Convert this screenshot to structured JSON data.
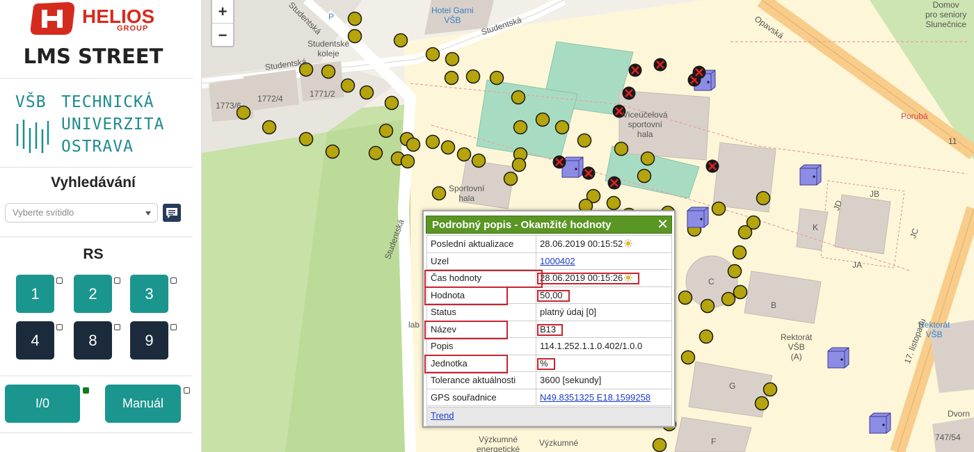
{
  "brand": {
    "name": "HELIOS",
    "subname": "GROUP"
  },
  "app_title": "LMS STREET",
  "university": {
    "line1": "VŠB",
    "line2": "TECHNICKÁ",
    "line3": "UNIVERZITA",
    "line4": "OSTRAVA"
  },
  "search": {
    "title": "Vyhledávání",
    "select_placeholder": "Vyberte svítidlo"
  },
  "rs": {
    "title": "RS",
    "buttons": [
      {
        "label": "1",
        "style": "teal"
      },
      {
        "label": "2",
        "style": "teal"
      },
      {
        "label": "3",
        "style": "teal"
      },
      {
        "label": "4",
        "style": "dark"
      },
      {
        "label": "8",
        "style": "dark"
      },
      {
        "label": "9",
        "style": "dark"
      }
    ]
  },
  "controls": {
    "io_label": "I/0",
    "io_led": "on",
    "manual_label": "Manuál",
    "manual_led": "off"
  },
  "map": {
    "zoom_in": "+",
    "zoom_out": "−",
    "labels": [
      {
        "text": "Studentská"
      },
      {
        "text": "Studentská"
      },
      {
        "text": "Studentská"
      },
      {
        "text": "Studentská"
      },
      {
        "text": "Studentské\nkoleje"
      },
      {
        "text": "Hotel Garni\nVŠB"
      },
      {
        "text": "Opavská"
      },
      {
        "text": "Domov\npro seniory\nSlunečnice"
      },
      {
        "text": "Porubá"
      },
      {
        "text": "1773/6"
      },
      {
        "text": "1772/4"
      },
      {
        "text": "1771/2"
      },
      {
        "text": "Viceúčelová\nsportovní\nhala"
      },
      {
        "text": "Sportovní\nhala"
      },
      {
        "text": "JB"
      },
      {
        "text": "JC"
      },
      {
        "text": "JD"
      },
      {
        "text": "JA"
      },
      {
        "text": "K"
      },
      {
        "text": "C"
      },
      {
        "text": "B"
      },
      {
        "text": "Rektorát\nVŠB\n(A)"
      },
      {
        "text": "Rektorát\nVŠB"
      },
      {
        "text": "G"
      },
      {
        "text": "F"
      },
      {
        "text": "17. listopadu"
      },
      {
        "text": "Dvorn"
      },
      {
        "text": "747/54"
      },
      {
        "text": "11"
      },
      {
        "text": "Výzkumné\nenergetické"
      },
      {
        "text": "Výzkumné"
      },
      {
        "text": "lab"
      },
      {
        "text": "P"
      }
    ]
  },
  "popup": {
    "title": "Podrobný popis - Okamžité hodnoty",
    "close": "✕",
    "rows": [
      {
        "key": "Poslední aktualizace",
        "value": "28.06.2019 00:15:52",
        "icon": "sun-icon",
        "link": false,
        "highlight": false
      },
      {
        "key": "Uzel",
        "value": "1000402",
        "link": true,
        "highlight": false
      },
      {
        "key": "Čas hodnoty",
        "value": "28.06.2019 00:15:26",
        "icon": "sun-icon",
        "link": false,
        "highlight": true
      },
      {
        "key": "Hodnota",
        "value": "50,00",
        "link": false,
        "highlight": true
      },
      {
        "key": "Status",
        "value": "platný údaj [0]",
        "link": false,
        "highlight": false
      },
      {
        "key": "Název",
        "value": "B13",
        "link": false,
        "highlight": true
      },
      {
        "key": "Popis",
        "value": "114.1.252.1.1.0.402/1.0.0",
        "link": false,
        "highlight": false
      },
      {
        "key": "Jednotka",
        "value": "%",
        "link": false,
        "highlight": true
      },
      {
        "key": "Tolerance aktuálnosti",
        "value": "3600 [sekundy]",
        "link": false,
        "highlight": false
      },
      {
        "key": "GPS souřadnice",
        "value": "N49.8351325 E18.1599258",
        "link": true,
        "highlight": false
      }
    ],
    "trend": "Trend"
  },
  "colors": {
    "teal": "#1a968f",
    "dark": "#1c2b3b",
    "brand_red": "#d52b1e",
    "popup_header": "#5a9624",
    "lamp": "#b5a40c"
  }
}
